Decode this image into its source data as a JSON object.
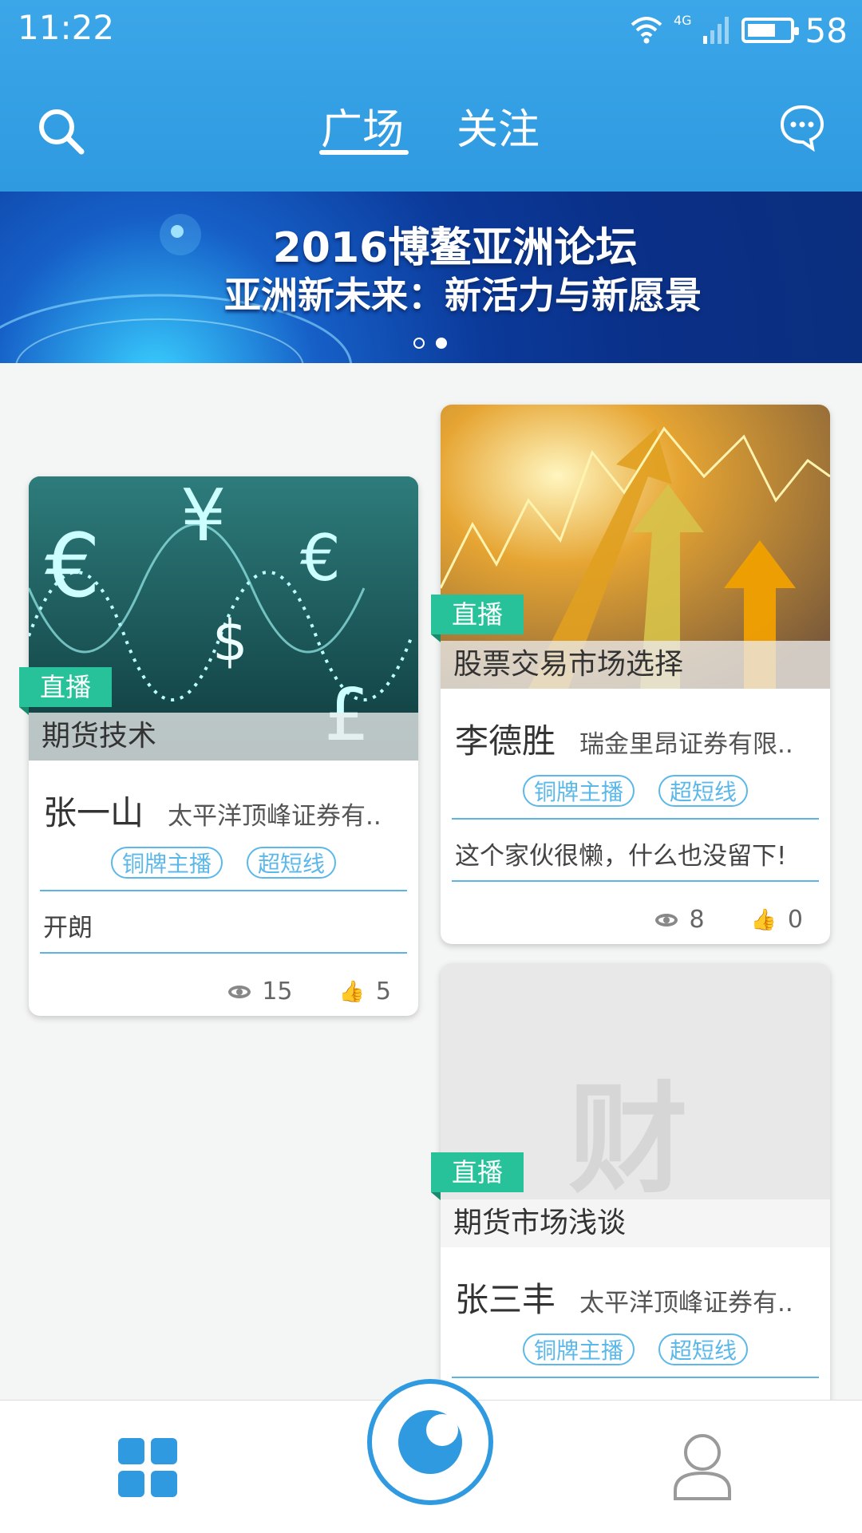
{
  "status_bar": {
    "time": "11:22",
    "network": "4G",
    "battery": "58"
  },
  "header": {
    "tabs": [
      {
        "label": "广场",
        "active": true
      },
      {
        "label": "关注",
        "active": false
      }
    ],
    "icons": {
      "left": "search-icon",
      "right": "chat-icon"
    }
  },
  "banner": {
    "line1": "2016博鳌亚洲论坛",
    "line2": "亚洲新未来：新活力与新愿景",
    "page_count": 2,
    "active_page": 2
  },
  "cards": [
    {
      "badge": "直播",
      "title": "期货技术",
      "author": "张一山",
      "org": "太平洋顶峰证券有..",
      "tags": [
        "铜牌主播",
        "超短线"
      ],
      "description": "开朗",
      "views": "15",
      "likes": "5"
    },
    {
      "badge": "直播",
      "title": "股票交易市场选择",
      "author": "李德胜",
      "org": "瑞金里昂证券有限..",
      "tags": [
        "铜牌主播",
        "超短线"
      ],
      "description": "这个家伙很懒，什么也没留下!",
      "views": "8",
      "likes": "0"
    },
    {
      "badge": "直播",
      "title": "期货市场浅谈",
      "author": "张三丰",
      "org": "太平洋顶峰证券有..",
      "tags": [
        "铜牌主播",
        "超短线"
      ],
      "placeholder_logo": "财"
    }
  ],
  "bottom_nav": {
    "items": [
      "grid-icon",
      "live-camera-icon",
      "profile-icon"
    ]
  },
  "colors": {
    "primary": "#2f9ae0",
    "live_badge": "#27c29a",
    "tag": "#5cb8e8"
  }
}
